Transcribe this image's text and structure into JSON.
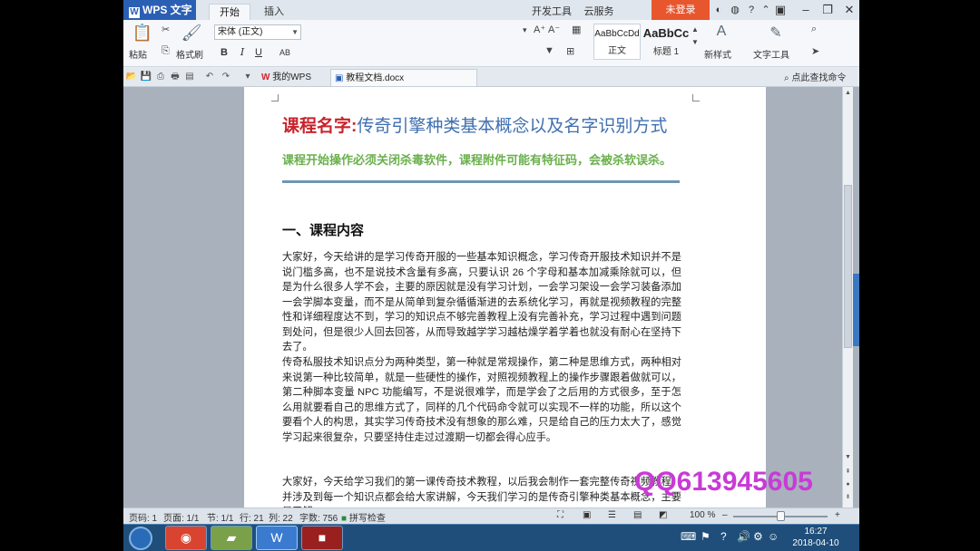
{
  "titlebar": {
    "app_name": "WPS 文字",
    "tabs": [
      "开始",
      "插入"
    ],
    "right_tabs": [
      "开发工具",
      "云服务"
    ],
    "login": "未登录"
  },
  "ribbon": {
    "paste": "粘贴",
    "format_painter": "格式刷",
    "font": "宋体 (正文)",
    "bold": "B",
    "italic": "I",
    "underline": "U",
    "strike": "AB",
    "styles": [
      {
        "sample": "AaBbCcDd",
        "name": "正文"
      },
      {
        "sample": "AaBbCc",
        "name": "标题 1"
      }
    ],
    "new_style": "新样式",
    "text_tools": "文字工具"
  },
  "docbar": {
    "tabs": [
      {
        "label": "我的WPS"
      },
      {
        "label": "教程文档.docx"
      }
    ],
    "search_cmd": "点此查找命令"
  },
  "document": {
    "title_red": "课程名字:",
    "title_blue": "传奇引擎种类基本概念以及名字识别方式",
    "warning": "课程开始操作必须关闭杀毒软件，课程附件可能有特征码，会被杀软误杀。",
    "heading": "一、课程内容",
    "para1": "大家好，今天给讲的是学习传奇开服的一些基本知识概念，学习传奇开服技术知识并不是说门槛多高，也不是说技术含量有多高，只要认识 26 个字母和基本加减乘除就可以，但是为什么很多人学不会，主要的原因就是没有学习计划，一会学习架设一会学习装备添加一会学脚本变量，而不是从简单到复杂循循渐进的去系统化学习，再就是视频教程的完整性和详细程度达不到，学习的知识点不够完善教程上没有完善补充，学习过程中遇到问题到处问，但是很少人回去回答，从而导致越学学习越枯燥学着学着也就没有耐心在坚持下去了。",
    "para2": "传奇私服技术知识点分为两种类型，第一种就是常规操作，第二种是思维方式，两种相对来说第一种比较简单，就是一些硬性的操作，对照视频教程上的操作步骤跟着做就可以，第二种脚本变量 NPC 功能编写，不是说很难学，而是学会了之后用的方式很多，至于怎么用就要看自己的思维方式了，同样的几个代码命令就可以实现不一样的功能，所以这个要看个人的构思，其实学习传奇技术没有想象的那么难，只是给自己的压力太大了，感觉学习起来很复杂，只要坚持住走过过渡期一切都会得心应手。",
    "para3": "大家好，今天给学习我们的第一课传奇技术教程，以后我会制作一套完整传奇视频教程，并涉及到每一个知识点都会给大家讲解，今天我们学习的是传奇引擎种类基本概念，主要是了解"
  },
  "watermark": "QQ613945605",
  "statusbar": {
    "page": "页码: 1",
    "pages": "页面: 1/1",
    "section": "节: 1/1",
    "row": "行: 21",
    "col": "列: 22",
    "words": "字数: 756",
    "spell": "拼写检查",
    "zoom": "100 %",
    "zoom_fraction": 0.5
  },
  "taskbar": {
    "time": "16:27",
    "date": "2018-04-10"
  }
}
